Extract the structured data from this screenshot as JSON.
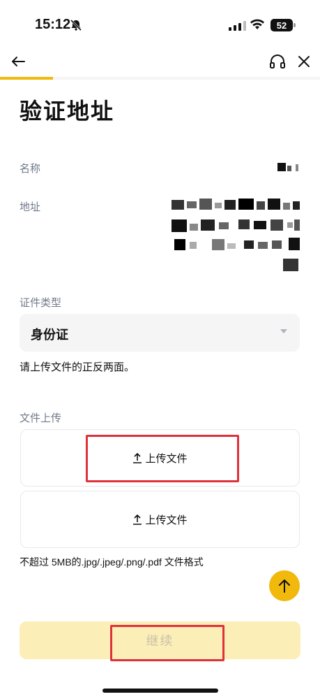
{
  "status_bar": {
    "time": "15:12",
    "battery": "52"
  },
  "nav": {
    "progress_fraction": 0.165
  },
  "page": {
    "title": "验证地址"
  },
  "fields": {
    "name_label": "名称",
    "address_label": "地址"
  },
  "document": {
    "type_label": "证件类型",
    "selected_type": "身份证",
    "hint": "请上传文件的正反两面。"
  },
  "upload": {
    "section_label": "文件上传",
    "buttons": [
      "上传文件",
      "上传文件"
    ],
    "format_note": "不超过 5MB的.jpg/.jpeg/.png/.pdf 文件格式"
  },
  "footer": {
    "continue_label": "继续"
  },
  "colors": {
    "accent": "#f0b90b",
    "highlight": "#e0313b",
    "muted_text": "#707a8a",
    "continue_bg": "#fbeeb7"
  }
}
